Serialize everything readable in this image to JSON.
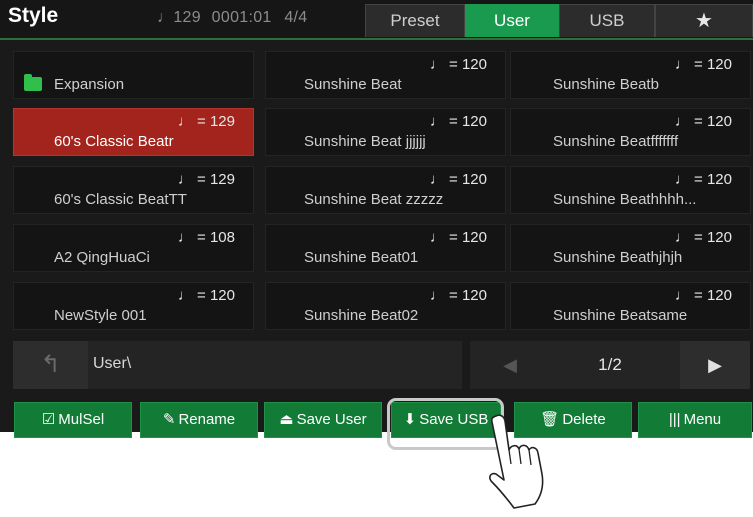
{
  "header": {
    "title": "Style",
    "tempo_symbol": "♩",
    "tempo": "129",
    "measure": "0001:01",
    "time_signature": "4/4",
    "tabs": [
      {
        "label": "Preset",
        "active": false
      },
      {
        "label": "User",
        "active": true
      },
      {
        "label": "USB",
        "active": false
      },
      {
        "label": "★",
        "active": false,
        "icon": "star-icon"
      }
    ]
  },
  "grid": {
    "cells": [
      {
        "name": "Expansion",
        "tempo": "",
        "type": "folder",
        "selected": false
      },
      {
        "name": "Sunshine Beat",
        "tempo": "♩ = 120",
        "selected": false
      },
      {
        "name": "Sunshine Beatb",
        "tempo": "♩ = 120",
        "selected": false
      },
      {
        "name": "60's Classic Beatr",
        "tempo": "♩ = 129",
        "selected": true
      },
      {
        "name": "Sunshine Beat jjjjjj",
        "tempo": "♩ = 120",
        "selected": false
      },
      {
        "name": "Sunshine Beatfffffff",
        "tempo": "♩ = 120",
        "selected": false
      },
      {
        "name": "60's Classic BeatTT",
        "tempo": "♩ = 129",
        "selected": false
      },
      {
        "name": "Sunshine Beat zzzzz",
        "tempo": "♩ = 120",
        "selected": false
      },
      {
        "name": "Sunshine Beathhhh...",
        "tempo": "♩ = 120",
        "selected": false
      },
      {
        "name": "A2 QingHuaCi",
        "tempo": "♩ = 108",
        "selected": false
      },
      {
        "name": "Sunshine Beat01",
        "tempo": "♩ = 120",
        "selected": false
      },
      {
        "name": "Sunshine Beathjhjh",
        "tempo": "♩ = 120",
        "selected": false
      },
      {
        "name": "NewStyle 001",
        "tempo": "♩ = 120",
        "selected": false
      },
      {
        "name": "Sunshine Beat02",
        "tempo": "♩ = 120",
        "selected": false
      },
      {
        "name": "Sunshine Beatsame",
        "tempo": "♩ = 120",
        "selected": false
      }
    ]
  },
  "path": {
    "back_icon": "back-arrow-icon",
    "back_symbol": "↰",
    "current": "User\\"
  },
  "pager": {
    "prev_symbol": "◀",
    "next_symbol": "▶",
    "page": "1/2"
  },
  "toolbar": {
    "buttons": [
      {
        "label": "MulSel",
        "icon": "multi-select-icon",
        "symbol": "☑"
      },
      {
        "label": "Rename",
        "icon": "rename-pen-icon",
        "symbol": "✎"
      },
      {
        "label": "Save User",
        "icon": "save-user-icon",
        "symbol": "⏏"
      },
      {
        "label": "Save USB",
        "icon": "save-usb-icon",
        "symbol": "⬇"
      },
      {
        "label": "Delete",
        "icon": "trash-icon",
        "symbol": "🗑"
      },
      {
        "label": "Menu",
        "icon": "menu-bars-icon",
        "symbol": "|||"
      }
    ]
  },
  "colors": {
    "accent_green": "#1a9a4e",
    "button_green": "#127c36",
    "selected_red": "#a3241c",
    "folder_green": "#2fbf4a"
  }
}
